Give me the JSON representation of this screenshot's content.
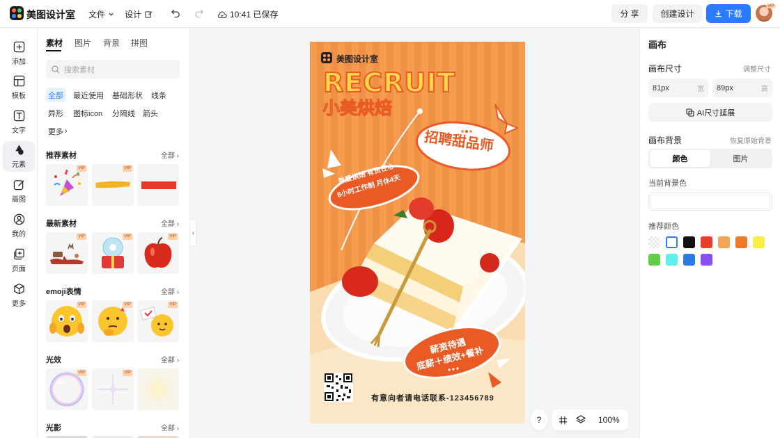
{
  "topbar": {
    "app_name": "美图设计室",
    "menu_file": "文件",
    "menu_design": "设计",
    "save_status": "10:41 已保存",
    "share_label": "分 享",
    "create_label": "创建设计",
    "download_label": "下载",
    "avatar_badge": "VIP"
  },
  "leftnav": {
    "items": [
      {
        "label": "添加",
        "icon": "plus-square-icon"
      },
      {
        "label": "模板",
        "icon": "layout-icon"
      },
      {
        "label": "文字",
        "icon": "text-icon"
      },
      {
        "label": "元素",
        "icon": "shapes-icon"
      },
      {
        "label": "画图",
        "icon": "edit-icon"
      },
      {
        "label": "我的",
        "icon": "user-icon"
      },
      {
        "label": "页面",
        "icon": "add-page-icon"
      },
      {
        "label": "更多",
        "icon": "cube-icon"
      }
    ],
    "active_index": 3
  },
  "panel": {
    "tabs": [
      "素材",
      "图片",
      "背景",
      "拼图"
    ],
    "search_placeholder": "搜索素材",
    "chips": [
      "全部",
      "最近使用",
      "基础形状",
      "线条",
      "异形",
      "图标icon",
      "分隔线",
      "箭头",
      "更多"
    ],
    "all_label": "全部",
    "vip": "VIP",
    "sections": [
      "推荐素材",
      "最新素材",
      "emoji表情",
      "光效",
      "光影"
    ]
  },
  "poster": {
    "brand": "美图设计室",
    "headline": "RECRUIT",
    "shop": "小美烘焙",
    "bubble_main": "招聘甜品师",
    "bubble_left_1": "热爱烘焙 有责任心",
    "bubble_left_2": "8小时工作制 月休4天",
    "bubble_bottom_1": "薪资待遇",
    "bubble_bottom_2": "底薪＋绩效+餐补",
    "contact": "有意向者请电话联系-123456789"
  },
  "bottom_tools": {
    "help": "?",
    "zoom": "100%"
  },
  "rightpanel": {
    "title": "画布",
    "size_title": "画布尺寸",
    "size_action": "调整尺寸",
    "width_value": "81px",
    "width_unit": "宽",
    "height_value": "89px",
    "height_unit": "高",
    "ai_extend": "AI尺寸延展",
    "bg_title": "画布背景",
    "bg_reset": "恢复原始背景",
    "seg_color": "颜色",
    "seg_image": "图片",
    "current_bg": "当前背景色",
    "recommended": "推荐颜色",
    "swatches": [
      "transparent",
      "#ffffff",
      "#111111",
      "#e83e2a",
      "#f2a457",
      "#ee7b2b",
      "#f7ef46",
      "#5fcf48",
      "#5ff0ee",
      "#2b7ae6",
      "#8a4ff0"
    ]
  },
  "colors": {
    "accent": "#2a7bff",
    "poster_orange": "#f39a4e",
    "poster_red": "#e95a24"
  }
}
